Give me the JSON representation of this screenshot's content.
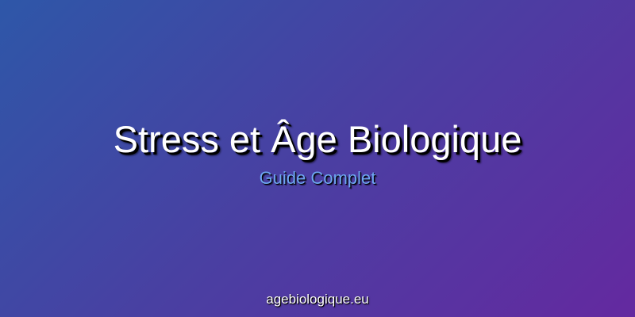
{
  "banner": {
    "title": "Stress et Âge Biologique",
    "subtitle": "Guide Complet",
    "site": "agebiologique.eu"
  },
  "colors": {
    "gradient_start": "#2e57a8",
    "gradient_end": "#6429a0",
    "subtitle": "#6ea6f2",
    "title": "#ffffff"
  }
}
